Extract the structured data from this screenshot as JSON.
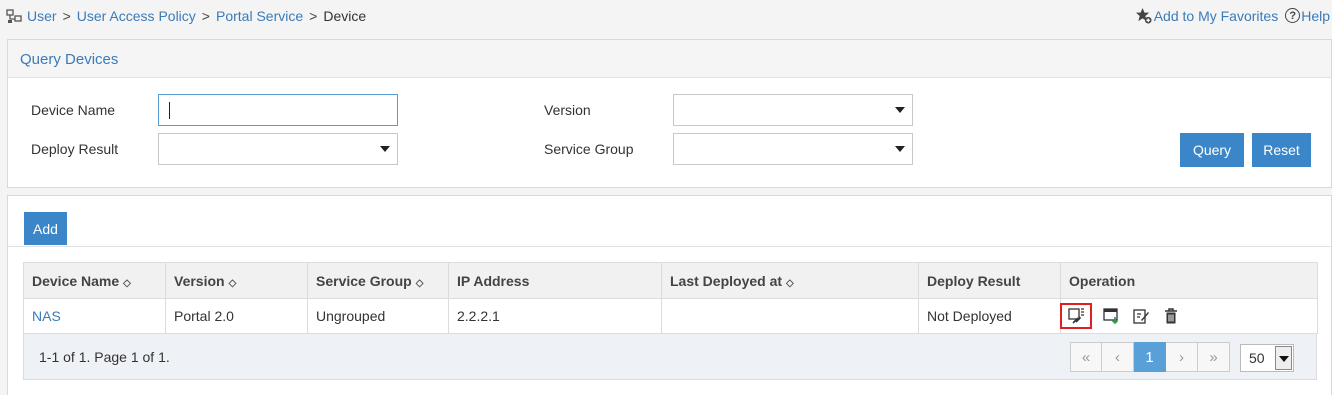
{
  "breadcrumb": {
    "items": [
      "User",
      "User Access Policy",
      "Portal Service"
    ],
    "current": "Device",
    "separator": ">"
  },
  "toplinks": {
    "favorites": "Add to My Favorites",
    "help": "Help"
  },
  "query": {
    "title": "Query Devices",
    "device_name_label": "Device Name",
    "device_name_value": "",
    "version_label": "Version",
    "version_value": "",
    "deploy_result_label": "Deploy Result",
    "deploy_result_value": "",
    "service_group_label": "Service Group",
    "service_group_value": "",
    "query_button": "Query",
    "reset_button": "Reset"
  },
  "list": {
    "add_button": "Add",
    "columns": [
      "Device Name",
      "Version",
      "Service Group",
      "IP Address",
      "Last Deployed at",
      "Deploy Result",
      "Operation"
    ],
    "sortable": [
      true,
      true,
      true,
      false,
      true,
      false,
      false
    ],
    "rows": [
      {
        "device_name": "NAS",
        "version": "Portal 2.0",
        "service_group": "Ungrouped",
        "ip_address": "2.2.2.1",
        "last_deployed": "",
        "deploy_result": "Not Deployed",
        "operations": [
          "deploy-icon",
          "export-icon",
          "edit-icon",
          "delete-icon"
        ]
      }
    ]
  },
  "pager": {
    "info": "1-1 of 1. Page 1 of 1.",
    "first": "«",
    "prev": "‹",
    "current_page": "1",
    "next": "›",
    "last": "»",
    "page_size": "50"
  },
  "colors": {
    "accent": "#3a86c8",
    "link": "#3a7bb8",
    "highlight": "#e02020"
  }
}
